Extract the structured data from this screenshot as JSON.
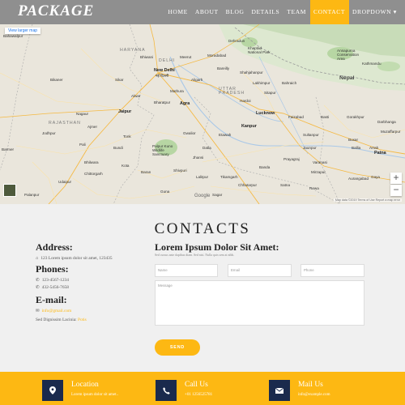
{
  "brand": {
    "logo": "PACKAGE"
  },
  "nav": {
    "items": [
      {
        "label": "HOME"
      },
      {
        "label": "ABOUT"
      },
      {
        "label": "BLOG"
      },
      {
        "label": "DETAILS"
      },
      {
        "label": "TEAM"
      },
      {
        "label": "CONTACT"
      },
      {
        "label": "DROPDOWN ▾"
      }
    ]
  },
  "map": {
    "larger_map_link": "View larger map",
    "zoom_in": "+",
    "zoom_out": "−",
    "google": "Google",
    "attribution": "Map data ©2019   Terms of Use   Report a map error",
    "countries": {
      "nepal": "Nepal"
    },
    "states": {
      "haryana": "HARYANA",
      "delhi": "DELHI",
      "uttar_pradesh": "UTTAR\nPRADESH",
      "rajasthan": "RAJASTHAN"
    },
    "cities": {
      "bahawalpur": "Bahawalpur",
      "new_delhi": "New Delhi",
      "new_delhi_hi": "नई दिल्ली",
      "bikaner": "Bikaner",
      "jaipur": "Jaipur",
      "agra": "Agra",
      "lucknow": "Lucknow",
      "kanpur": "Kanpur",
      "gwalior": "Gwalior",
      "jhansi": "Jhansi",
      "allahabad": "Prayagraj",
      "varanasi": "Varanasi",
      "gorakhpur": "Gorakhpur",
      "patna": "Patna",
      "gaya": "Gaya",
      "kathmandu": "Kathmandu",
      "bareilly": "Bareilly",
      "jodhpur": "Jodhpur",
      "ajmer": "Ajmer",
      "udaipur": "Udaipur",
      "kota": "Kota",
      "bhilwara": "Bhilwara",
      "aurangabad": "Aurangabad",
      "jaunpur": "Jaunpur",
      "rewa": "Rewa",
      "satna": "Satna",
      "sagar": "Sagar",
      "darbhanga": "Darbhanga",
      "muzaffarpur": "Muzaffarpur",
      "dehradun": "Dehradun",
      "palanpur": "Palanpur",
      "chittorgarh": "Chittorgarh",
      "guna": "Guna",
      "faizabad": "Faizabad",
      "bahraich": "Bahraich",
      "sikar": "Sikar",
      "bhiwani": "Bhiwani",
      "meerut": "Meerut",
      "aligarh": "Aligarh",
      "mathura": "Mathura",
      "alwar": "Alwar",
      "bharatpur": "Bharatpur",
      "moradabad": "Moradabad",
      "shahjahanpur": "Shahjahanpur",
      "lakhimpur": "Lakhimpur",
      "sitapur": "Sitapur",
      "hardoi": "Hardoi",
      "etawah": "Etawah",
      "sultanpur": "Sultanpur",
      "basti": "Basti",
      "ballia": "Ballia",
      "arrah": "Arrah",
      "nagaur": "Nagaur",
      "pali": "Pali",
      "barmer": "Barmer",
      "tonk": "Tonk",
      "bundi": "Bundi",
      "baran": "Baran",
      "shivpuri": "Shivpuri",
      "datia": "Datia",
      "lalitpur": "Lalitpur",
      "tikamgarh": "Tikamgarh",
      "chhatarpur": "Chhatarpur",
      "banda": "Banda",
      "mirzapur": "Mirzapur",
      "buxar": "Buxar"
    },
    "parks": {
      "palpur_kuno": "Palpur Kuno\nWildlife\nSanctuary",
      "annapurna": "Annapurna\nConservation\nArea",
      "khaptad": "Khaptad\nNational Park"
    }
  },
  "contacts": {
    "title": "CONTACTS",
    "address_heading": "Address:",
    "address_line": "123 Lorem ipsum dolor sit amet, 123435",
    "phones_heading": "Phones:",
    "phone1": "123-4567-1234",
    "phone2": "432-5456-7658",
    "email_heading": "E-mail:",
    "email": "info@gmail.com",
    "note_prefix": "Sed Dignissim Lacinia:",
    "note_link": "Potis",
    "form_title": "Lorem Ipsum Dolor Sit Amet:",
    "form_subtitle": "Sed cursus ante dapibus diam. Sed nisi. Nulla quis sem at nibh.",
    "placeholders": {
      "name": "Name",
      "email": "Email",
      "phone": "Phone",
      "message": "Message"
    },
    "send_label": "SEND"
  },
  "footer": {
    "items": [
      {
        "title": "Location",
        "text": "Lorem ipsum dolor sit amet.."
      },
      {
        "title": "Call Us",
        "text": "+01 1256525781"
      },
      {
        "title": "Mail Us",
        "text": "info@example.com"
      }
    ]
  },
  "colors": {
    "accent": "#fdb813",
    "navbar": "#8f8f8f",
    "footer_icon_bg": "#1a2a4d",
    "page_bg": "#f0f0f0"
  }
}
